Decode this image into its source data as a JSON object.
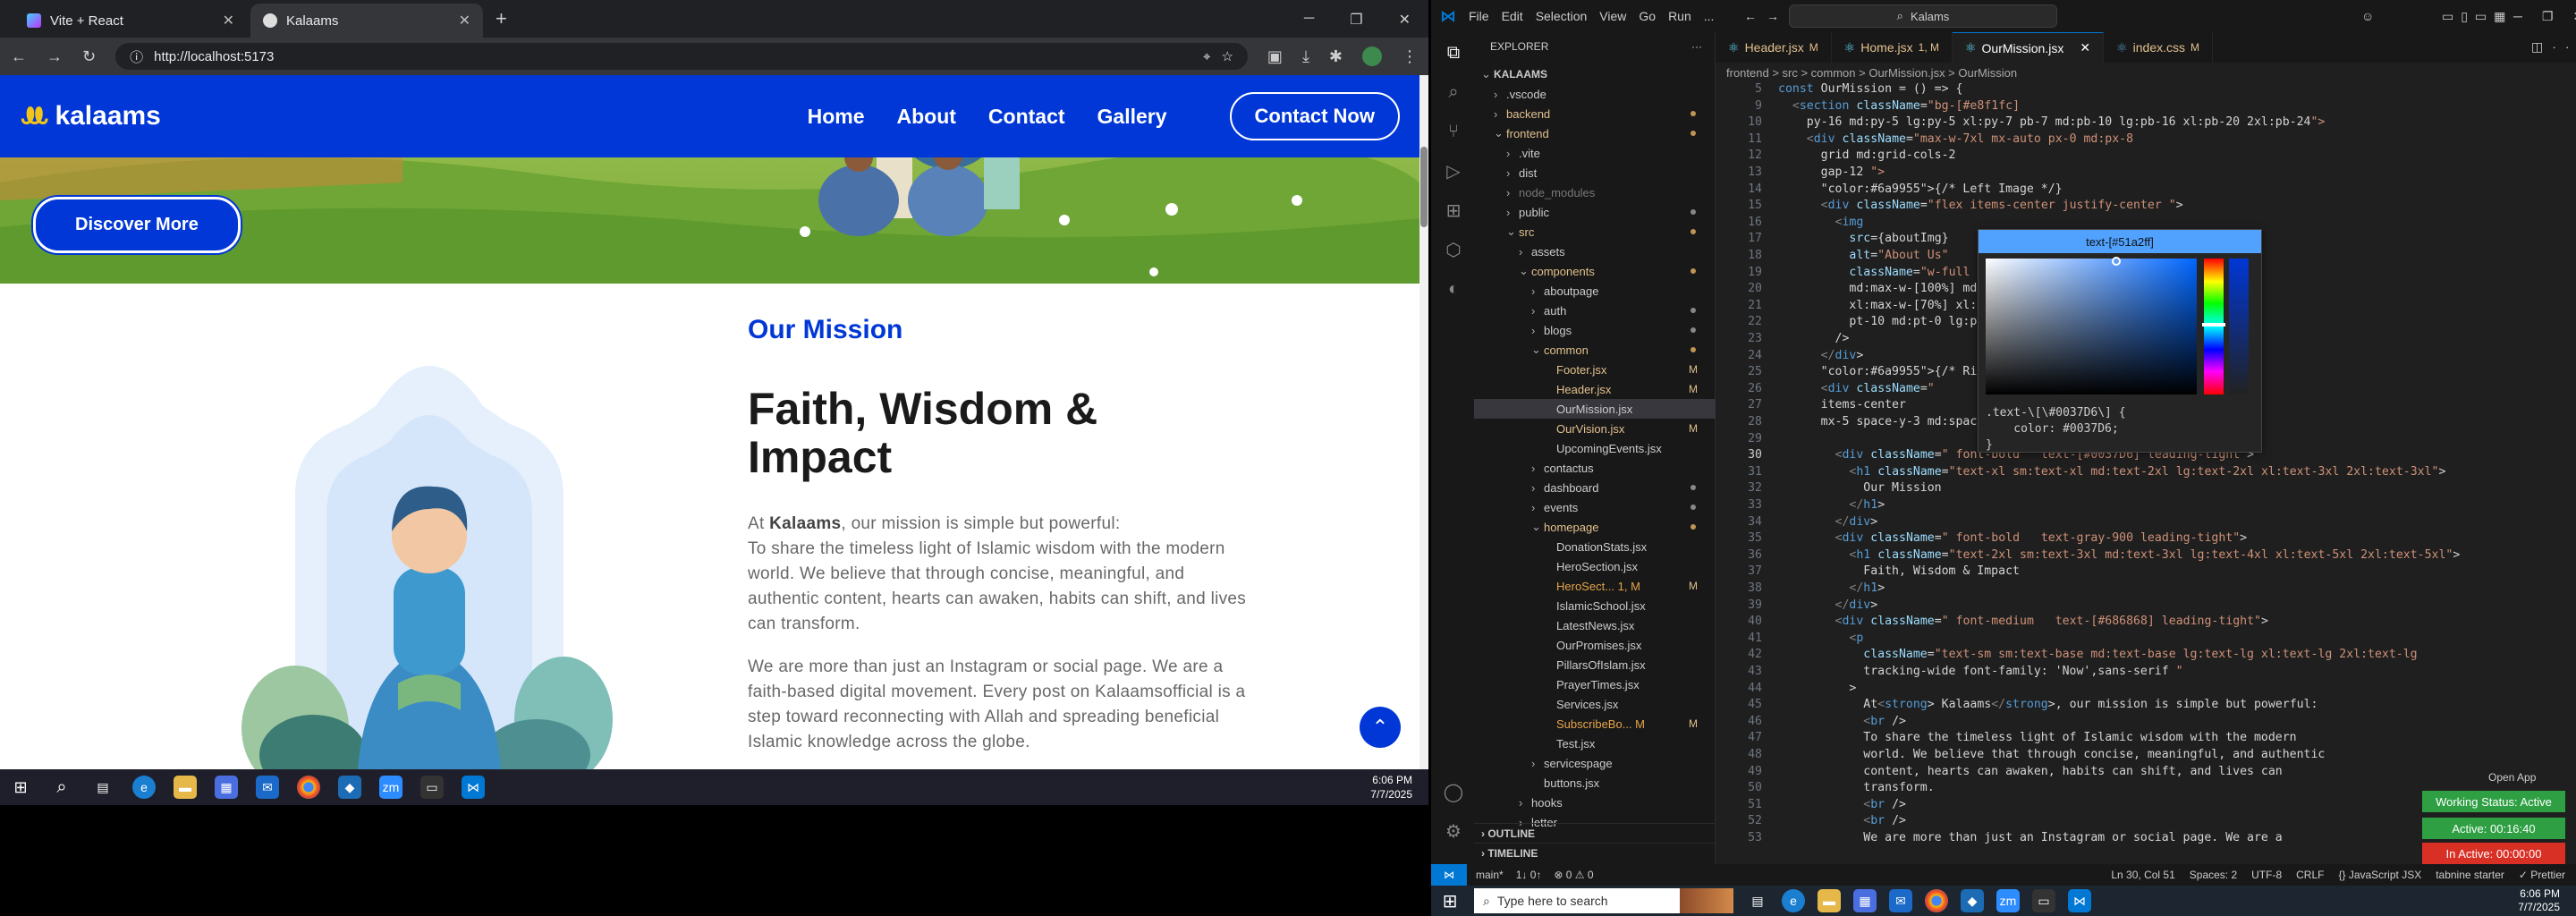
{
  "browser": {
    "tabs": [
      {
        "title": "Vite + React",
        "active": false
      },
      {
        "title": "Kalaams",
        "active": true
      }
    ],
    "url": "http://localhost:5173"
  },
  "site": {
    "logo": "kalaams",
    "nav": [
      "Home",
      "About",
      "Contact",
      "Gallery"
    ],
    "cta": "Contact Now",
    "discover": "Discover More",
    "mission_label": "Our Mission",
    "mission_title": "Faith, Wisdom & Impact",
    "p1_pre": "At ",
    "p1_strong": "Kalaams",
    "p1_post": ", our mission is simple but powerful:",
    "p2": "To share the timeless light of Islamic wisdom with the modern world. We believe that through concise, meaningful, and authentic content, hearts can awaken, habits can shift, and lives can transform.",
    "p3": "We are more than just an Instagram or social page. We are a faith-based digital movement. Every post on Kalaamsofficial is a step toward reconnecting with Allah and spreading beneficial Islamic knowledge across the globe."
  },
  "taskbar_left": {
    "time": "6:06 PM",
    "date": "7/7/2025"
  },
  "vscode": {
    "menu": [
      "File",
      "Edit",
      "Selection",
      "View",
      "Go",
      "Run",
      "..."
    ],
    "command_center": "Kalams",
    "explorer_title": "EXPLORER",
    "tree": [
      {
        "label": "KALAAMS",
        "depth": 0,
        "arrow": "⌄",
        "bold": true
      },
      {
        "label": ".vscode",
        "depth": 1,
        "arrow": "›"
      },
      {
        "label": "backend",
        "depth": 1,
        "arrow": "›",
        "dot": "#c09553"
      },
      {
        "label": "frontend",
        "depth": 1,
        "arrow": "⌄",
        "dot": "#c09553"
      },
      {
        "label": ".vite",
        "depth": 2,
        "arrow": "›"
      },
      {
        "label": "dist",
        "depth": 2,
        "arrow": "›"
      },
      {
        "label": "node_modules",
        "depth": 2,
        "arrow": "›",
        "dim": true
      },
      {
        "label": "public",
        "depth": 2,
        "arrow": "›",
        "dot": "#888"
      },
      {
        "label": "src",
        "depth": 2,
        "arrow": "⌄",
        "dot": "#c09553"
      },
      {
        "label": "assets",
        "depth": 3,
        "arrow": "›"
      },
      {
        "label": "components",
        "depth": 3,
        "arrow": "⌄",
        "dot": "#c09553"
      },
      {
        "label": "aboutpage",
        "depth": 4,
        "arrow": "›"
      },
      {
        "label": "auth",
        "depth": 4,
        "arrow": "›",
        "dot": "#888"
      },
      {
        "label": "blogs",
        "depth": 4,
        "arrow": "›",
        "dot": "#888"
      },
      {
        "label": "common",
        "depth": 4,
        "arrow": "⌄",
        "dot": "#c09553"
      },
      {
        "label": "Footer.jsx",
        "depth": 5,
        "mark": "M"
      },
      {
        "label": "Header.jsx",
        "depth": 5,
        "mark": "M"
      },
      {
        "label": "OurMission.jsx",
        "depth": 5,
        "selected": true
      },
      {
        "label": "OurVision.jsx",
        "depth": 5,
        "mark": "M"
      },
      {
        "label": "UpcomingEvents.jsx",
        "depth": 5
      },
      {
        "label": "contactus",
        "depth": 4,
        "arrow": "›"
      },
      {
        "label": "dashboard",
        "depth": 4,
        "arrow": "›",
        "dot": "#888"
      },
      {
        "label": "events",
        "depth": 4,
        "arrow": "›",
        "dot": "#888"
      },
      {
        "label": "homepage",
        "depth": 4,
        "arrow": "⌄",
        "dot": "#c09553"
      },
      {
        "label": "DonationStats.jsx",
        "depth": 5
      },
      {
        "label": "HeroSection.jsx",
        "depth": 5
      },
      {
        "label": "HeroSect... 1, M",
        "depth": 5,
        "mark": "M",
        "warn": true
      },
      {
        "label": "IslamicSchool.jsx",
        "depth": 5
      },
      {
        "label": "LatestNews.jsx",
        "depth": 5
      },
      {
        "label": "OurPromises.jsx",
        "depth": 5
      },
      {
        "label": "PillarsOfIslam.jsx",
        "depth": 5
      },
      {
        "label": "PrayerTimes.jsx",
        "depth": 5
      },
      {
        "label": "Services.jsx",
        "depth": 5
      },
      {
        "label": "SubscribeBo... M",
        "depth": 5,
        "mark": "M",
        "warn": true
      },
      {
        "label": "Test.jsx",
        "depth": 5
      },
      {
        "label": "servicespage",
        "depth": 4,
        "arrow": "›"
      },
      {
        "label": "buttons.jsx",
        "depth": 4
      },
      {
        "label": "hooks",
        "depth": 3,
        "arrow": "›"
      },
      {
        "label": "letter",
        "depth": 3,
        "arrow": "›"
      }
    ],
    "outline": "OUTLINE",
    "timeline": "TIMELINE",
    "tabs": [
      {
        "label": "Header.jsx",
        "mark": "M"
      },
      {
        "label": "Home.jsx",
        "mark": "1, M"
      },
      {
        "label": "OurMission.jsx",
        "mark": "",
        "active": true
      },
      {
        "label": "index.css",
        "mark": "M"
      }
    ],
    "breadcrumb": "frontend > src > common > OurMission.jsx > OurMission",
    "lines": [
      {
        "n": "5",
        "t": "const OurMission = () => {"
      },
      {
        "n": "9",
        "t": "  <section className=\"bg-[#e8f1fc]"
      },
      {
        "n": "10",
        "t": "    py-16 md:py-5 lg:py-5 xl:py-7 pb-7 md:pb-10 lg:pb-16 xl:pb-20 2xl:pb-24\">"
      },
      {
        "n": "11",
        "t": "    <div className=\"max-w-7xl mx-auto px-0 md:px-8"
      },
      {
        "n": "12",
        "t": "      grid md:grid-cols-2"
      },
      {
        "n": "13",
        "t": "      gap-12 \">"
      },
      {
        "n": "14",
        "t": "      {/* Left Image */}"
      },
      {
        "n": "15",
        "t": "      <div className=\"flex items-center justify-center \">"
      },
      {
        "n": "16",
        "t": "        <img"
      },
      {
        "n": "17",
        "t": "          src={aboutImg}"
      },
      {
        "n": "18",
        "t": "          alt=\"About Us\""
      },
      {
        "n": "19",
        "t": "          className=\"w-full max-w-[3"
      },
      {
        "n": "20",
        "t": "          md:max-w-[100%] md:h-[72%]"
      },
      {
        "n": "21",
        "t": "          xl:max-w-[70%] xl:h-[100%]"
      },
      {
        "n": "22",
        "t": "          pt-10 md:pt-0 lg:pt-0 xl:pt"
      },
      {
        "n": "23",
        "t": "        />"
      },
      {
        "n": "24",
        "t": "      </div>"
      },
      {
        "n": "25",
        "t": "      {/* Right Content */}"
      },
      {
        "n": "26",
        "t": "      <div className=\""
      },
      {
        "n": "27",
        "t": "      items-center"
      },
      {
        "n": "28",
        "t": "      mx-5 space-y-3 md:space-y-5 lg"
      },
      {
        "n": "29",
        "t": ""
      },
      {
        "n": "30",
        "t": "        <div className=\" font-bold   text-[#0037D6] leading-tight\">"
      },
      {
        "n": "31",
        "t": "          <h1 className=\"text-xl sm:text-xl md:text-2xl lg:text-2xl xl:text-3xl 2xl:text-3xl\">"
      },
      {
        "n": "32",
        "t": "            Our Mission"
      },
      {
        "n": "33",
        "t": "          </h1>"
      },
      {
        "n": "34",
        "t": "        </div>"
      },
      {
        "n": "35",
        "t": "        <div className=\" font-bold   text-gray-900 leading-tight\">"
      },
      {
        "n": "36",
        "t": "          <h1 className=\"text-2xl sm:text-3xl md:text-3xl lg:text-4xl xl:text-5xl 2xl:text-5xl\">"
      },
      {
        "n": "37",
        "t": "            Faith, Wisdom & Impact"
      },
      {
        "n": "38",
        "t": "          </h1>"
      },
      {
        "n": "39",
        "t": "        </div>"
      },
      {
        "n": "40",
        "t": "        <div className=\" font-medium   text-[#686868] leading-tight\">"
      },
      {
        "n": "41",
        "t": "          <p"
      },
      {
        "n": "42",
        "t": "            className=\"text-sm sm:text-base md:text-base lg:text-lg xl:text-lg 2xl:text-lg"
      },
      {
        "n": "43",
        "t": "            tracking-wide font-family: 'Now',sans-serif \""
      },
      {
        "n": "44",
        "t": "          >"
      },
      {
        "n": "45",
        "t": "            At<strong> Kalaams</strong>, our mission is simple but powerful:"
      },
      {
        "n": "46",
        "t": "            <br />"
      },
      {
        "n": "47",
        "t": "            To share the timeless light of Islamic wisdom with the modern"
      },
      {
        "n": "48",
        "t": "            world. We believe that through concise, meaningful, and authentic"
      },
      {
        "n": "49",
        "t": "            content, hearts can awaken, habits can shift, and lives can"
      },
      {
        "n": "50",
        "t": "            transform."
      },
      {
        "n": "51",
        "t": "            <br />"
      },
      {
        "n": "52",
        "t": "            <br />"
      },
      {
        "n": "53",
        "t": "            We are more than just an Instagram or social page. We are a"
      }
    ],
    "picker_header": "text-[#51a2ff]",
    "hover_text": ".text-\\[\\#0037D6\\] {\n    color: #0037D6;\n}",
    "status": {
      "branch": "main*",
      "sync": "1↓ 0↑",
      "errors": "⊗ 0 ⚠ 0",
      "position": "Ln 30, Col 51",
      "spaces": "Spaces: 2",
      "encoding": "UTF-8",
      "eol": "CRLF",
      "language": "{} JavaScript JSX",
      "tabnine": "tabnine starter",
      "prettier": "✓ Prettier"
    },
    "open_app": "Open App",
    "working_status": "Working Status: Active",
    "active_time": "Active: 00:16:40",
    "inactive_time": "In Active: 00:00:00"
  },
  "taskbar_right": {
    "search_placeholder": "Type here to search",
    "time": "6:06 PM",
    "date": "7/7/2025"
  }
}
